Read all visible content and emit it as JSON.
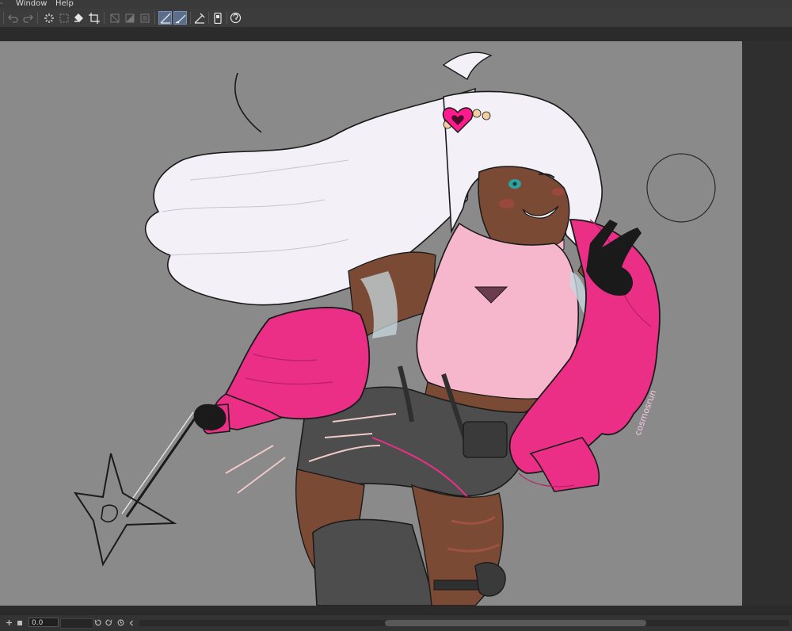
{
  "menu": {
    "items": [
      "Window",
      "Help"
    ]
  },
  "toolbar": {
    "icons": [
      "undo-icon",
      "redo-icon",
      "clear-icon",
      "select-all-icon",
      "fill-icon",
      "crop-icon",
      "transform-icon",
      "shade-icon",
      "frame-icon",
      "ruler-icon",
      "snap-icon",
      "ruler-angle-icon",
      "device-icon",
      "help-icon"
    ]
  },
  "timeline": {
    "frame_value": "0.0"
  },
  "signature": {
    "text": "cosmosrun"
  },
  "colors": {
    "canvas_bg": "#8a8a8a",
    "jacket": "#ec2f86",
    "top": "#f6b6cc",
    "hair": "#f3f0f8",
    "skin": "#7a4a34",
    "shorts": "#4d4d4d",
    "accent_heart": "#ff1b8d"
  }
}
